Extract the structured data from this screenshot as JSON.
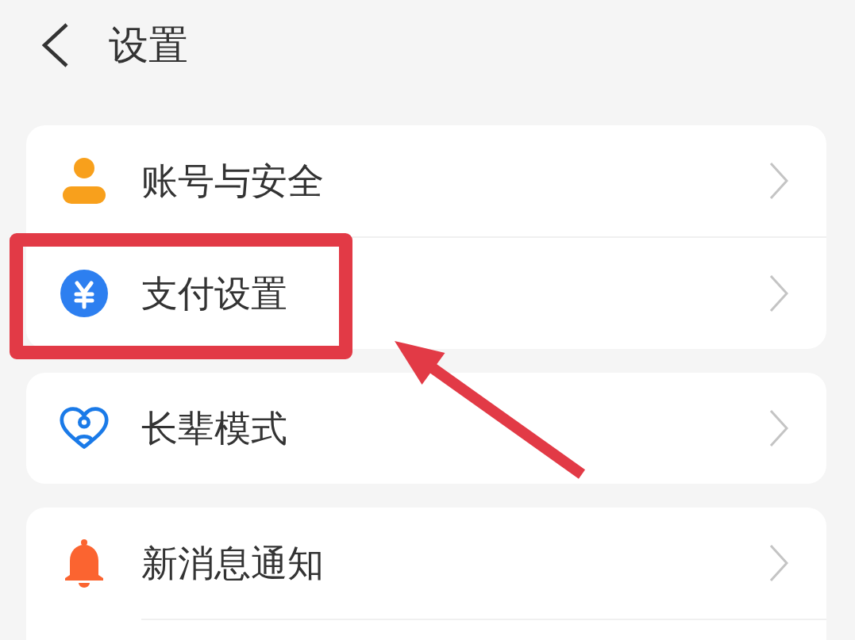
{
  "header": {
    "title": "设置"
  },
  "groups": [
    {
      "items": [
        {
          "label": "账号与安全",
          "highlighted": false
        },
        {
          "label": "支付设置",
          "highlighted": true
        }
      ]
    },
    {
      "items": [
        {
          "label": "长辈模式",
          "highlighted": false
        }
      ]
    },
    {
      "items": [
        {
          "label": "新消息通知",
          "highlighted": false
        }
      ]
    }
  ]
}
